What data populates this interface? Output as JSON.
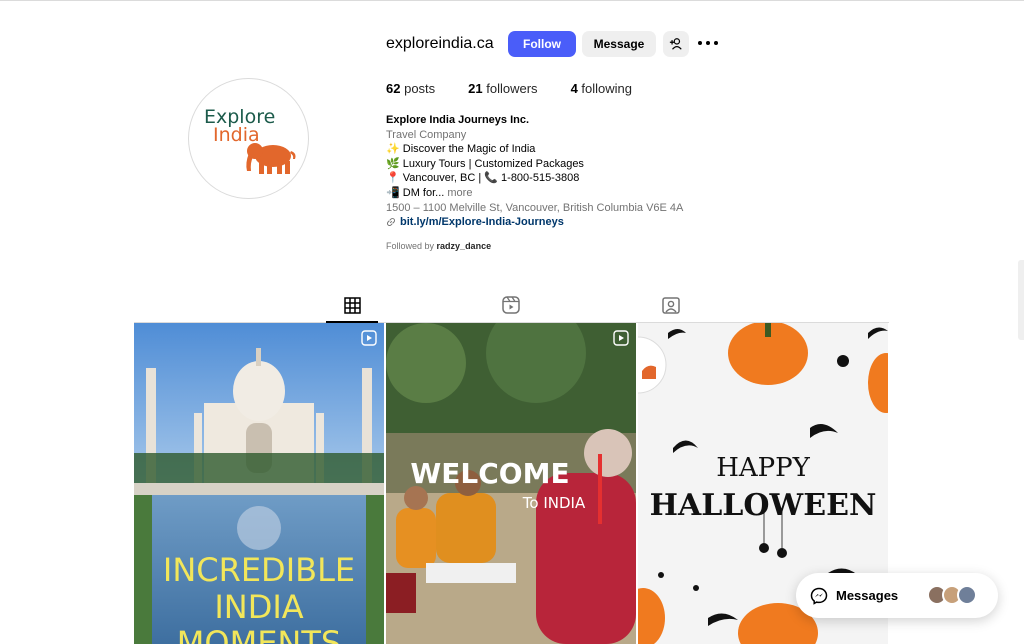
{
  "profile": {
    "username": "exploreindia.ca",
    "follow_label": "Follow",
    "message_label": "Message",
    "logo_text": [
      "Explore",
      "India"
    ],
    "stats": {
      "posts_count": "62",
      "posts_label": "posts",
      "followers_count": "21",
      "followers_label": "followers",
      "following_count": "4",
      "following_label": "following"
    },
    "bio": {
      "name": "Explore India Journeys Inc.",
      "category": "Travel Company",
      "line1": "✨ Discover the Magic of India",
      "line2": "🌿 Luxury Tours | Customized Packages",
      "line3": "📍 Vancouver, BC | 📞 1-800-515-3808",
      "line4": "📲 DM for...",
      "more_label": "more",
      "address": "1500 – 1100 Melville St, Vancouver, British Columbia V6E 4A",
      "link": "bit.ly/m/Explore-India-Journeys"
    },
    "followed_by_prefix": "Followed by",
    "followed_by_user": "radzy_dance"
  },
  "tabs": [
    "grid-icon",
    "reels-icon",
    "tagged-icon"
  ],
  "posts": [
    {
      "text_lines": [
        "INCREDIBLE",
        "INDIA",
        "MOMENTS"
      ]
    },
    {
      "title": "WELCOME",
      "subtitle": "To INDIA"
    },
    {
      "line1": "HAPPY",
      "line2": "HALLOWEEN"
    }
  ],
  "messages": {
    "label": "Messages"
  },
  "colors": {
    "follow_button": "#4a5df9",
    "link": "#00376b",
    "logo_green": "#1c5b4b",
    "logo_orange": "#e2672c"
  }
}
